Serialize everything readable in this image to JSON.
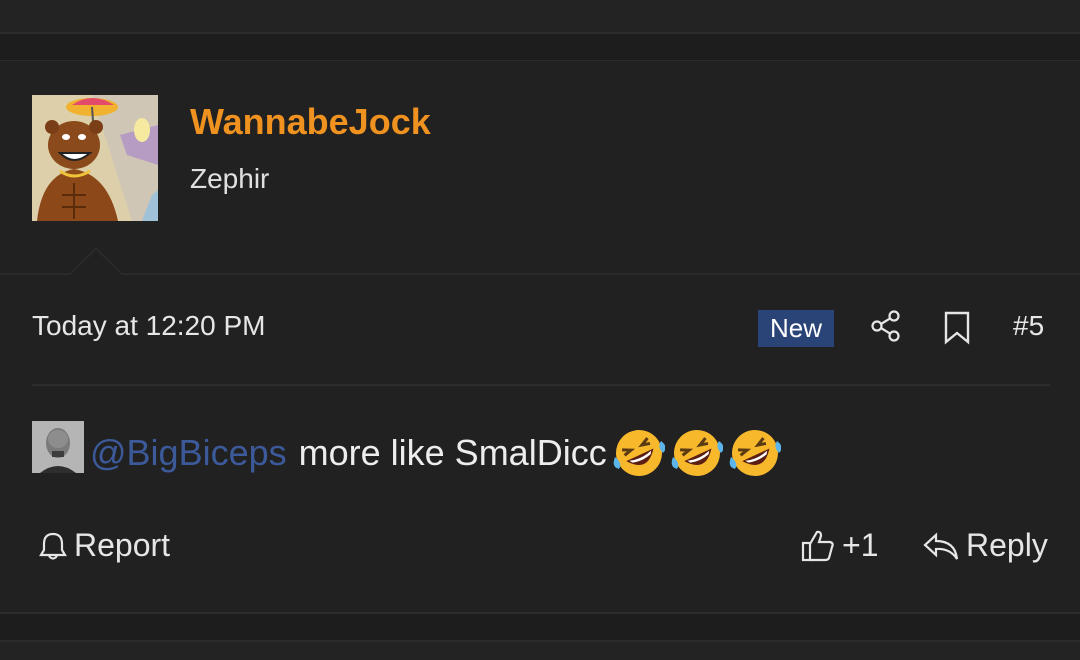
{
  "post": {
    "username": "WannabeJock",
    "user_title": "Zephir",
    "date": "Today at 12:20 PM",
    "new_badge": "New",
    "post_number": "#5",
    "mention": "@BigBiceps",
    "message_text": "more like SmalDicc",
    "emojis": [
      "rolling-on-floor-laughing",
      "rolling-on-floor-laughing",
      "rolling-on-floor-laughing"
    ],
    "actions": {
      "report": "Report",
      "like_count": "+1",
      "reply": "Reply"
    }
  },
  "colors": {
    "background": "#212122",
    "username": "#f0921f",
    "mention": "#3c5a99",
    "new_badge": "#2b4477"
  }
}
